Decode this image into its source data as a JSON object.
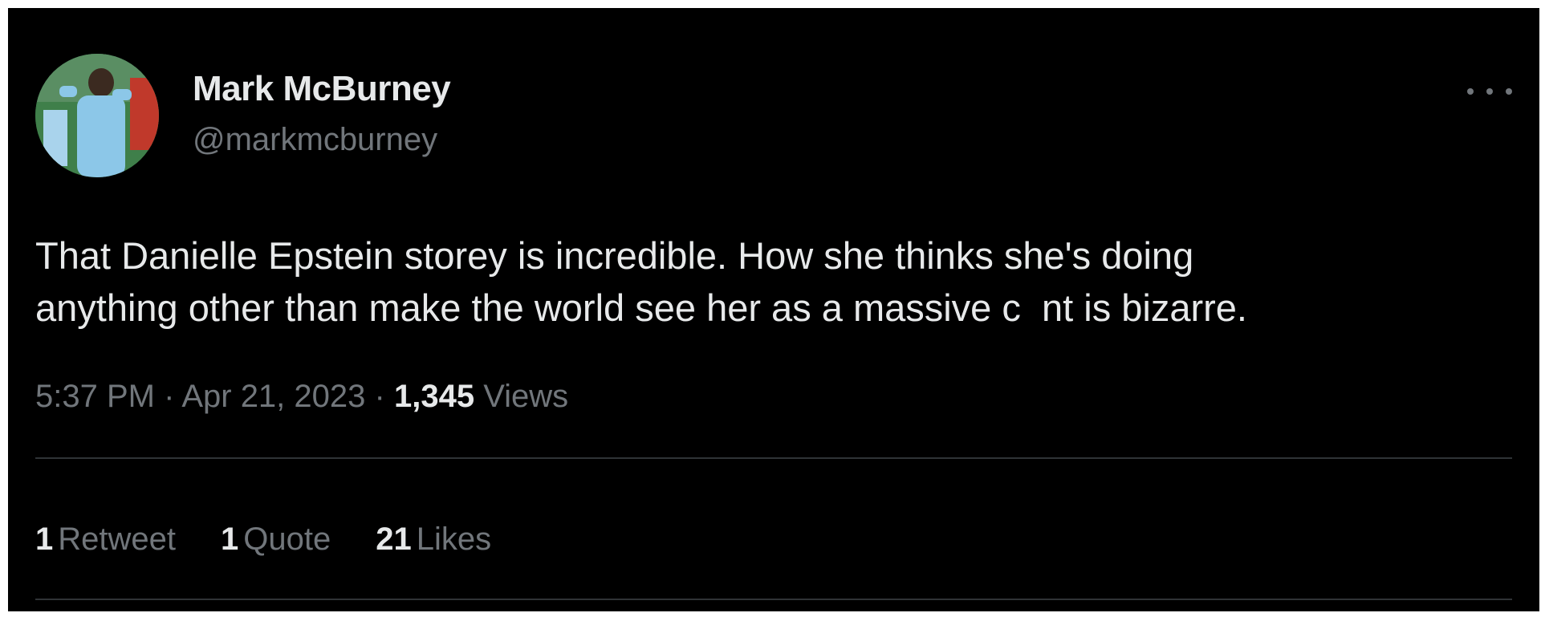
{
  "author": {
    "name": "Mark McBurney",
    "handle": "@markmcburney"
  },
  "tweet": {
    "text": "That Danielle Epstein storey is incredible. How she thinks she's doing\nanything other than make the world see her as a massive c  nt is bizarre.",
    "time": "5:37 PM",
    "separator": "·",
    "date": "Apr 21, 2023",
    "views_count": "1,345",
    "views_label": "Views"
  },
  "engagement": {
    "retweets_count": "1",
    "retweets_label": "Retweet",
    "quotes_count": "1",
    "quotes_label": "Quote",
    "likes_count": "21",
    "likes_label": "Likes"
  },
  "icons": {
    "more": "more-horizontal-icon"
  },
  "colors": {
    "background": "#000000",
    "text_primary": "#e7e9ea",
    "text_secondary": "#71767b",
    "divider": "#2f3336"
  }
}
